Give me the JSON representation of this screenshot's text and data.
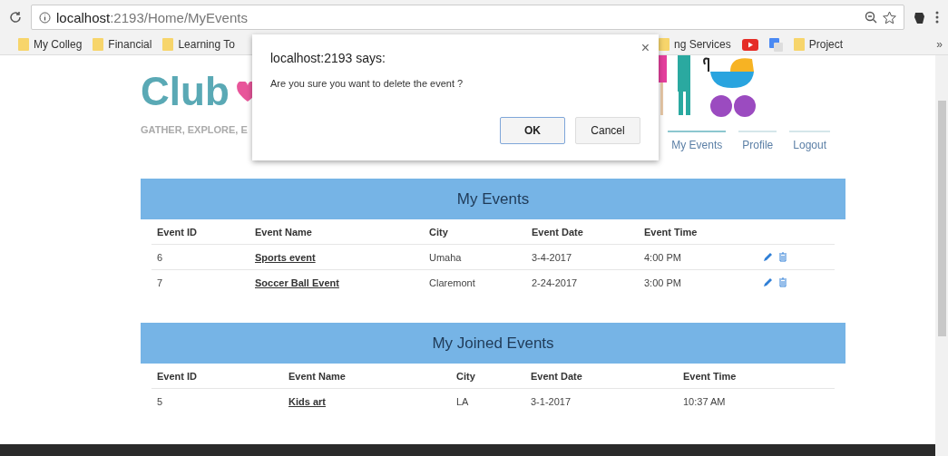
{
  "browser": {
    "url_host": "localhost",
    "url_rest": ":2193/Home/MyEvents",
    "bookmarks": [
      {
        "kind": "folder",
        "label": "My Colleg"
      },
      {
        "kind": "folder",
        "label": "Financial"
      },
      {
        "kind": "folder",
        "label": "Learning To"
      }
    ],
    "bookmarks_right": [
      {
        "kind": "folder",
        "label": "ng Services"
      },
      {
        "kind": "video"
      },
      {
        "kind": "translate"
      },
      {
        "kind": "folder",
        "label": "Project"
      }
    ],
    "more": "»"
  },
  "logo": {
    "title": "Club",
    "tagline": "GATHER, EXPLORE, E"
  },
  "nav": [
    {
      "label": "My Events",
      "selected": true
    },
    {
      "label": "Profile",
      "selected": false
    },
    {
      "label": "Logout",
      "selected": false
    }
  ],
  "tables": [
    {
      "title": "My Events",
      "kind": "owned",
      "columns": [
        "Event ID",
        "Event Name",
        "City",
        "Event Date",
        "Event Time"
      ],
      "rows": [
        {
          "id": "6",
          "name": "Sports event",
          "city": "Umaha",
          "date": "3-4-2017",
          "time": "4:00 PM"
        },
        {
          "id": "7",
          "name": "Soccer Ball Event",
          "city": "Claremont",
          "date": "2-24-2017",
          "time": "3:00 PM"
        }
      ]
    },
    {
      "title": "My Joined Events",
      "kind": "joined",
      "columns": [
        "Event ID",
        "Event Name",
        "City",
        "Event Date",
        "Event Time"
      ],
      "rows": [
        {
          "id": "5",
          "name": "Kids art",
          "city": "LA",
          "date": "3-1-2017",
          "time": "10:37 AM"
        }
      ]
    }
  ],
  "dialog": {
    "close": "×",
    "title": "localhost:2193 says:",
    "message": "Are you sure you want to delete the event ?",
    "buttons": [
      {
        "label": "OK",
        "focused": true
      },
      {
        "label": "Cancel",
        "focused": false
      }
    ]
  }
}
